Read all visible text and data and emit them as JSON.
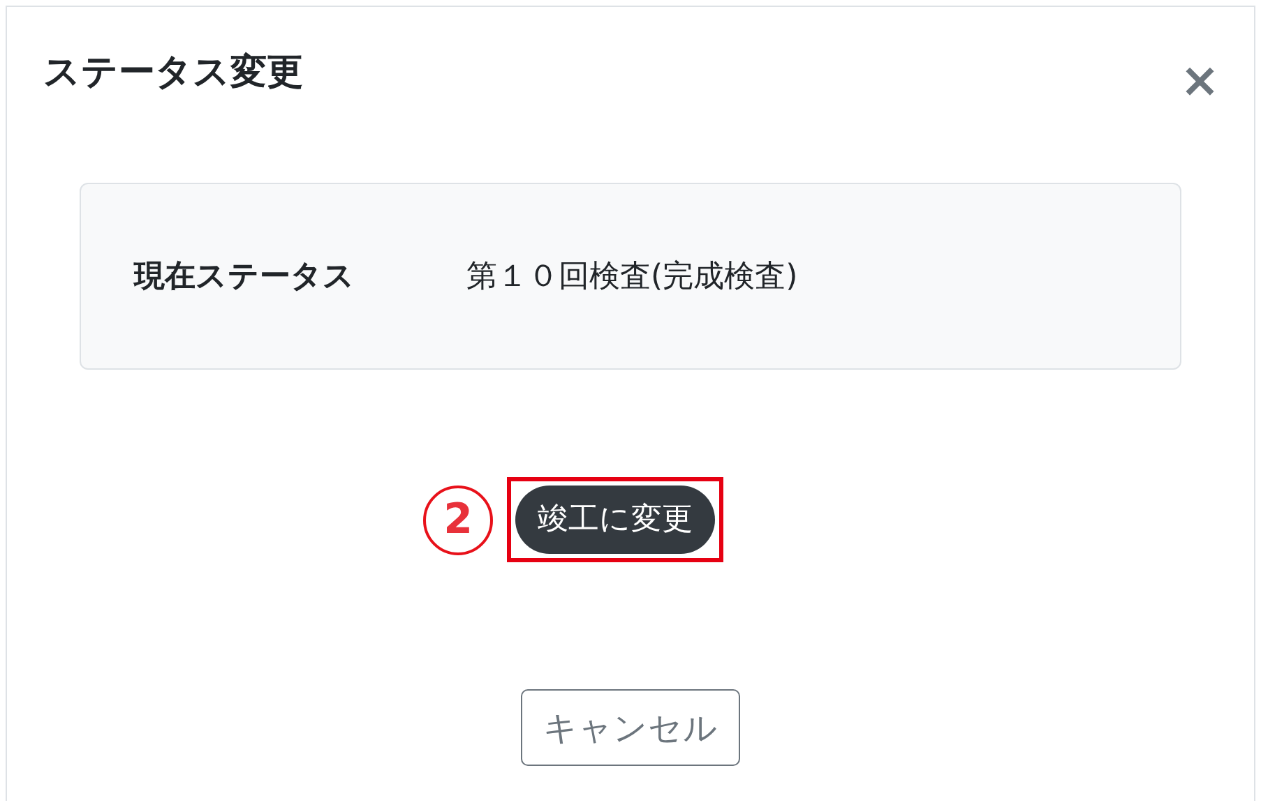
{
  "dialog": {
    "title": "ステータス変更",
    "close": "×"
  },
  "status": {
    "label": "現在ステータス",
    "value": "第１０回検査(完成検査)"
  },
  "action": {
    "step": "2",
    "label": "竣工に変更",
    "highlighted": true
  },
  "cancel": {
    "label": "キャンセル"
  }
}
